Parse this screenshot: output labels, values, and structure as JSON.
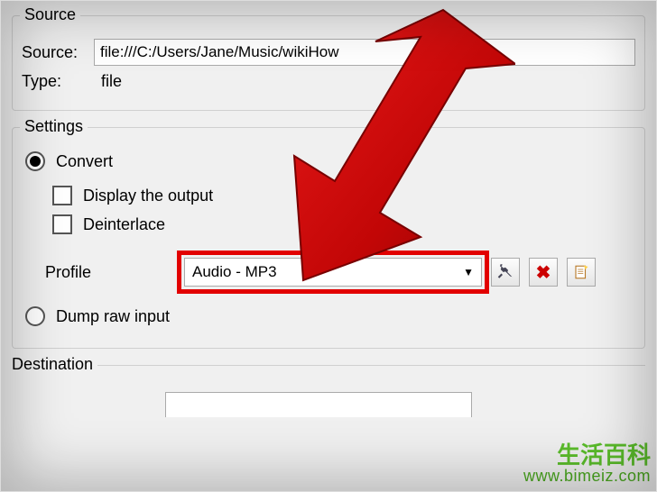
{
  "source_group": {
    "title": "Source",
    "source_label": "Source:",
    "source_value": "file:///C:/Users/Jane/Music/wikiHow",
    "type_label": "Type:",
    "type_value": "file"
  },
  "settings_group": {
    "title": "Settings",
    "convert_label": "Convert",
    "display_output_label": "Display the output",
    "deinterlace_label": "Deinterlace",
    "profile_label": "Profile",
    "profile_value": "Audio - MP3",
    "dump_raw_label": "Dump raw input"
  },
  "destination_group": {
    "title": "Destination"
  },
  "icons": {
    "tools": "tools-icon",
    "delete": "delete-icon",
    "new": "new-profile-icon"
  },
  "watermark": {
    "cn": "生活百科",
    "url": "www.bimeiz.com"
  }
}
